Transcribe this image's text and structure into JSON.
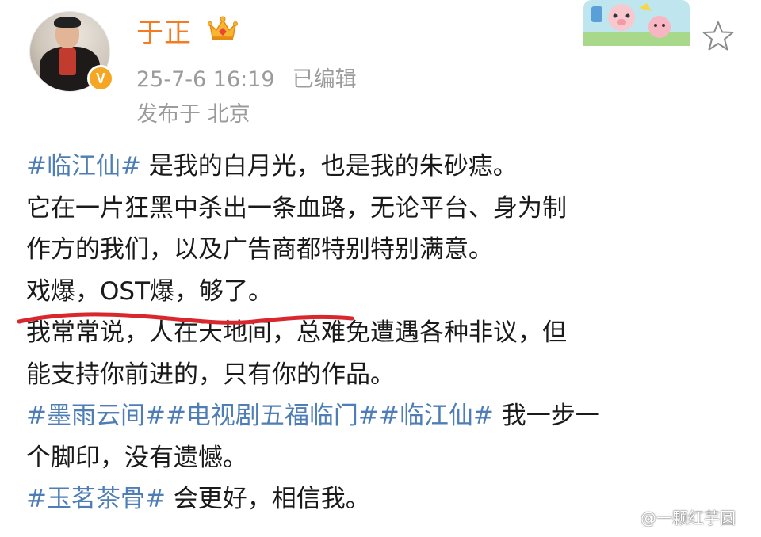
{
  "post": {
    "username": "于正",
    "timestamp": "25-7-6 16:19",
    "edited_label": "已编辑",
    "location": "发布于 北京",
    "verified_letter": "V"
  },
  "content": {
    "line1": {
      "tag": "#临江仙#",
      "text": " 是我的白月光，也是我的朱砂痣。"
    },
    "line2": "它在一片狂黑中杀出一条血路，无论平台、身为制",
    "line3": "作方的我们，以及广告商都特别特别满意。",
    "line4": "戏爆，OST爆，够了。",
    "line5": "我常常说，人在天地间，总难免遭遇各种非议，但",
    "line6": "能支持你前进的，只有你的作品。",
    "line7": {
      "tag1": "#墨雨云间#",
      "tag2": "#电视剧五福临门#",
      "tag3": "#临江仙#",
      "text": " 我一步一"
    },
    "line8": "个脚印，没有遗憾。",
    "line9": {
      "tag": "#玉茗茶骨#",
      "text": " 会更好，相信我。"
    }
  },
  "watermark": {
    "text": "@一颗红芋圆"
  },
  "colors": {
    "username": "#f47b20",
    "hashtag": "#4e7eb5",
    "meta": "#9b9b9b",
    "underline": "#d8272d",
    "verified_badge": "#f5a623"
  },
  "icons": [
    "crown-icon",
    "star-icon",
    "verified-badge-icon",
    "weibo-logo-icon"
  ]
}
